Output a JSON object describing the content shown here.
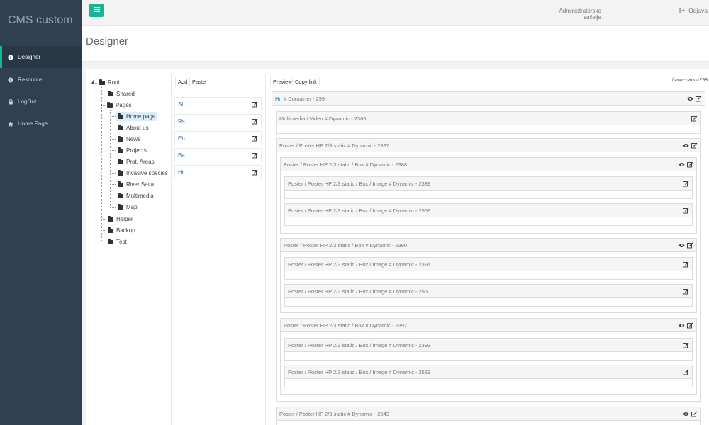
{
  "sidebar": {
    "brand": "CMS custom",
    "items": [
      {
        "label": "Designer",
        "icon": "info-circle-icon"
      },
      {
        "label": "Resource",
        "icon": "info-circle-icon"
      },
      {
        "label": "LogOut",
        "icon": "lock-icon"
      },
      {
        "label": "Home Page",
        "icon": "home-icon"
      }
    ]
  },
  "topbar": {
    "menu_icon": "hamburger-icon",
    "admin_label": "Administratorsko sučelje",
    "logout_label": "Odjava"
  },
  "page": {
    "title": "Designer"
  },
  "tree": {
    "root": "Root",
    "items": [
      {
        "label": "Shared"
      },
      {
        "label": "Pages",
        "children": [
          "Home page",
          "About us",
          "News",
          "Projects",
          "Prot. Areas",
          "Invasive species",
          "River Sava",
          "Multimedia",
          "Map"
        ]
      },
      {
        "label": "Helper"
      },
      {
        "label": "Backup"
      },
      {
        "label": "Test"
      }
    ],
    "selected": "Home page"
  },
  "languages": {
    "add_label": "Add",
    "paste_label": "Paste",
    "items": [
      "Si",
      "Rs",
      "En",
      "Ba",
      "Hr"
    ]
  },
  "designer": {
    "preview_label": "Preview",
    "copy_link_label": "Copy link",
    "slug": "/sava-parks-299",
    "container": {
      "lang": "Hr",
      "rest": "#  Container - 299"
    },
    "blocks": {
      "video": "Multimedia / Video  #  Dynamic - 2386",
      "poster1": "Poster / Poster HP 2/3 static  #  Dynamic - 2387",
      "box1": "Poster / Poster HP 2/3 static / Box  #  Dynamic - 2388",
      "img1a": "Poster / Poster HP 2/3 static / Box / Image  #  Dynamic - 2389",
      "img1b": "Poster / Poster HP 2/3 static / Box / Image  #  Dynamic - 2559",
      "box2": "Poster / Poster HP 2/3 static / Box  #  Dynamic - 2390",
      "img2a": "Poster / Poster HP 2/3 static / Box / Image  #  Dynamic - 2391",
      "img2b": "Poster / Poster HP 2/3 static / Box / Image  #  Dynamic - 2560",
      "box3": "Poster / Poster HP 2/3 static / Box  #  Dynamic - 2392",
      "img3a": "Poster / Poster HP 2/3 static / Box / Image  #  Dynamic - 2393",
      "img3b": "Poster / Poster HP 2/3 static / Box / Image  #  Dynamic - 2563",
      "poster2": "Poster / Poster HP 2/3 static  #  Dynamic - 2543"
    }
  },
  "colors": {
    "sidebar": "#2f4050",
    "accent": "#1ab394",
    "link": "#337ab7"
  }
}
